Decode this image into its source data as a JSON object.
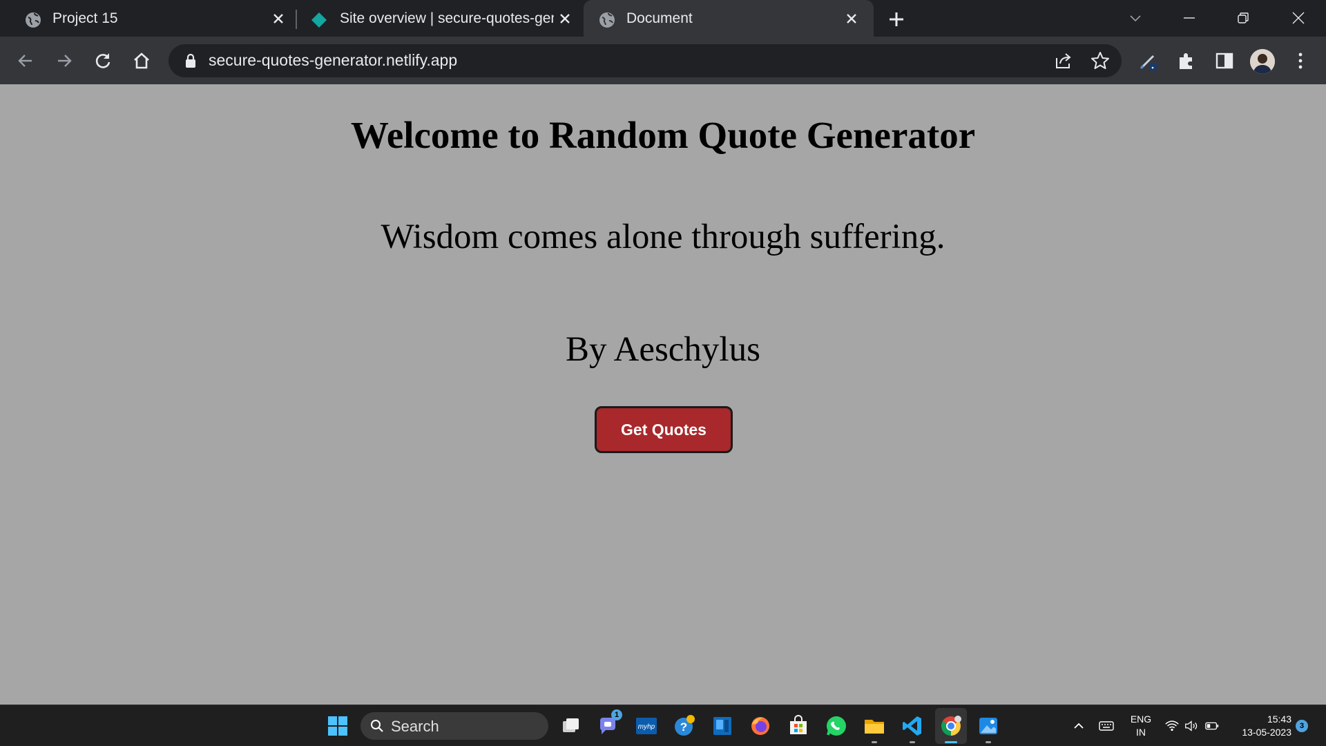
{
  "browser": {
    "tabs": [
      {
        "title": "Project 15",
        "active": false
      },
      {
        "title": "Site overview | secure-quotes-generator",
        "active": false
      },
      {
        "title": "Document",
        "active": true
      }
    ],
    "url": "secure-quotes-generator.netlify.app"
  },
  "page": {
    "heading": "Welcome to Random Quote Generator",
    "quote": "Wisdom comes alone through suffering.",
    "author": "By Aeschylus",
    "button_label": "Get Quotes",
    "button_color": "#a8282b",
    "background_color": "#a6a6a6"
  },
  "taskbar": {
    "search_label": "Search",
    "apps": [
      "windows-start",
      "task-view",
      "teams-chat",
      "myhp",
      "get-help",
      "app-blue",
      "firefox",
      "microsoft-store",
      "whatsapp",
      "file-explorer",
      "vscode",
      "chrome",
      "photos"
    ],
    "teams_badge": "1",
    "language": "ENG",
    "region": "IN",
    "time": "15:43",
    "date": "13-05-2023",
    "notification_count": "3"
  }
}
